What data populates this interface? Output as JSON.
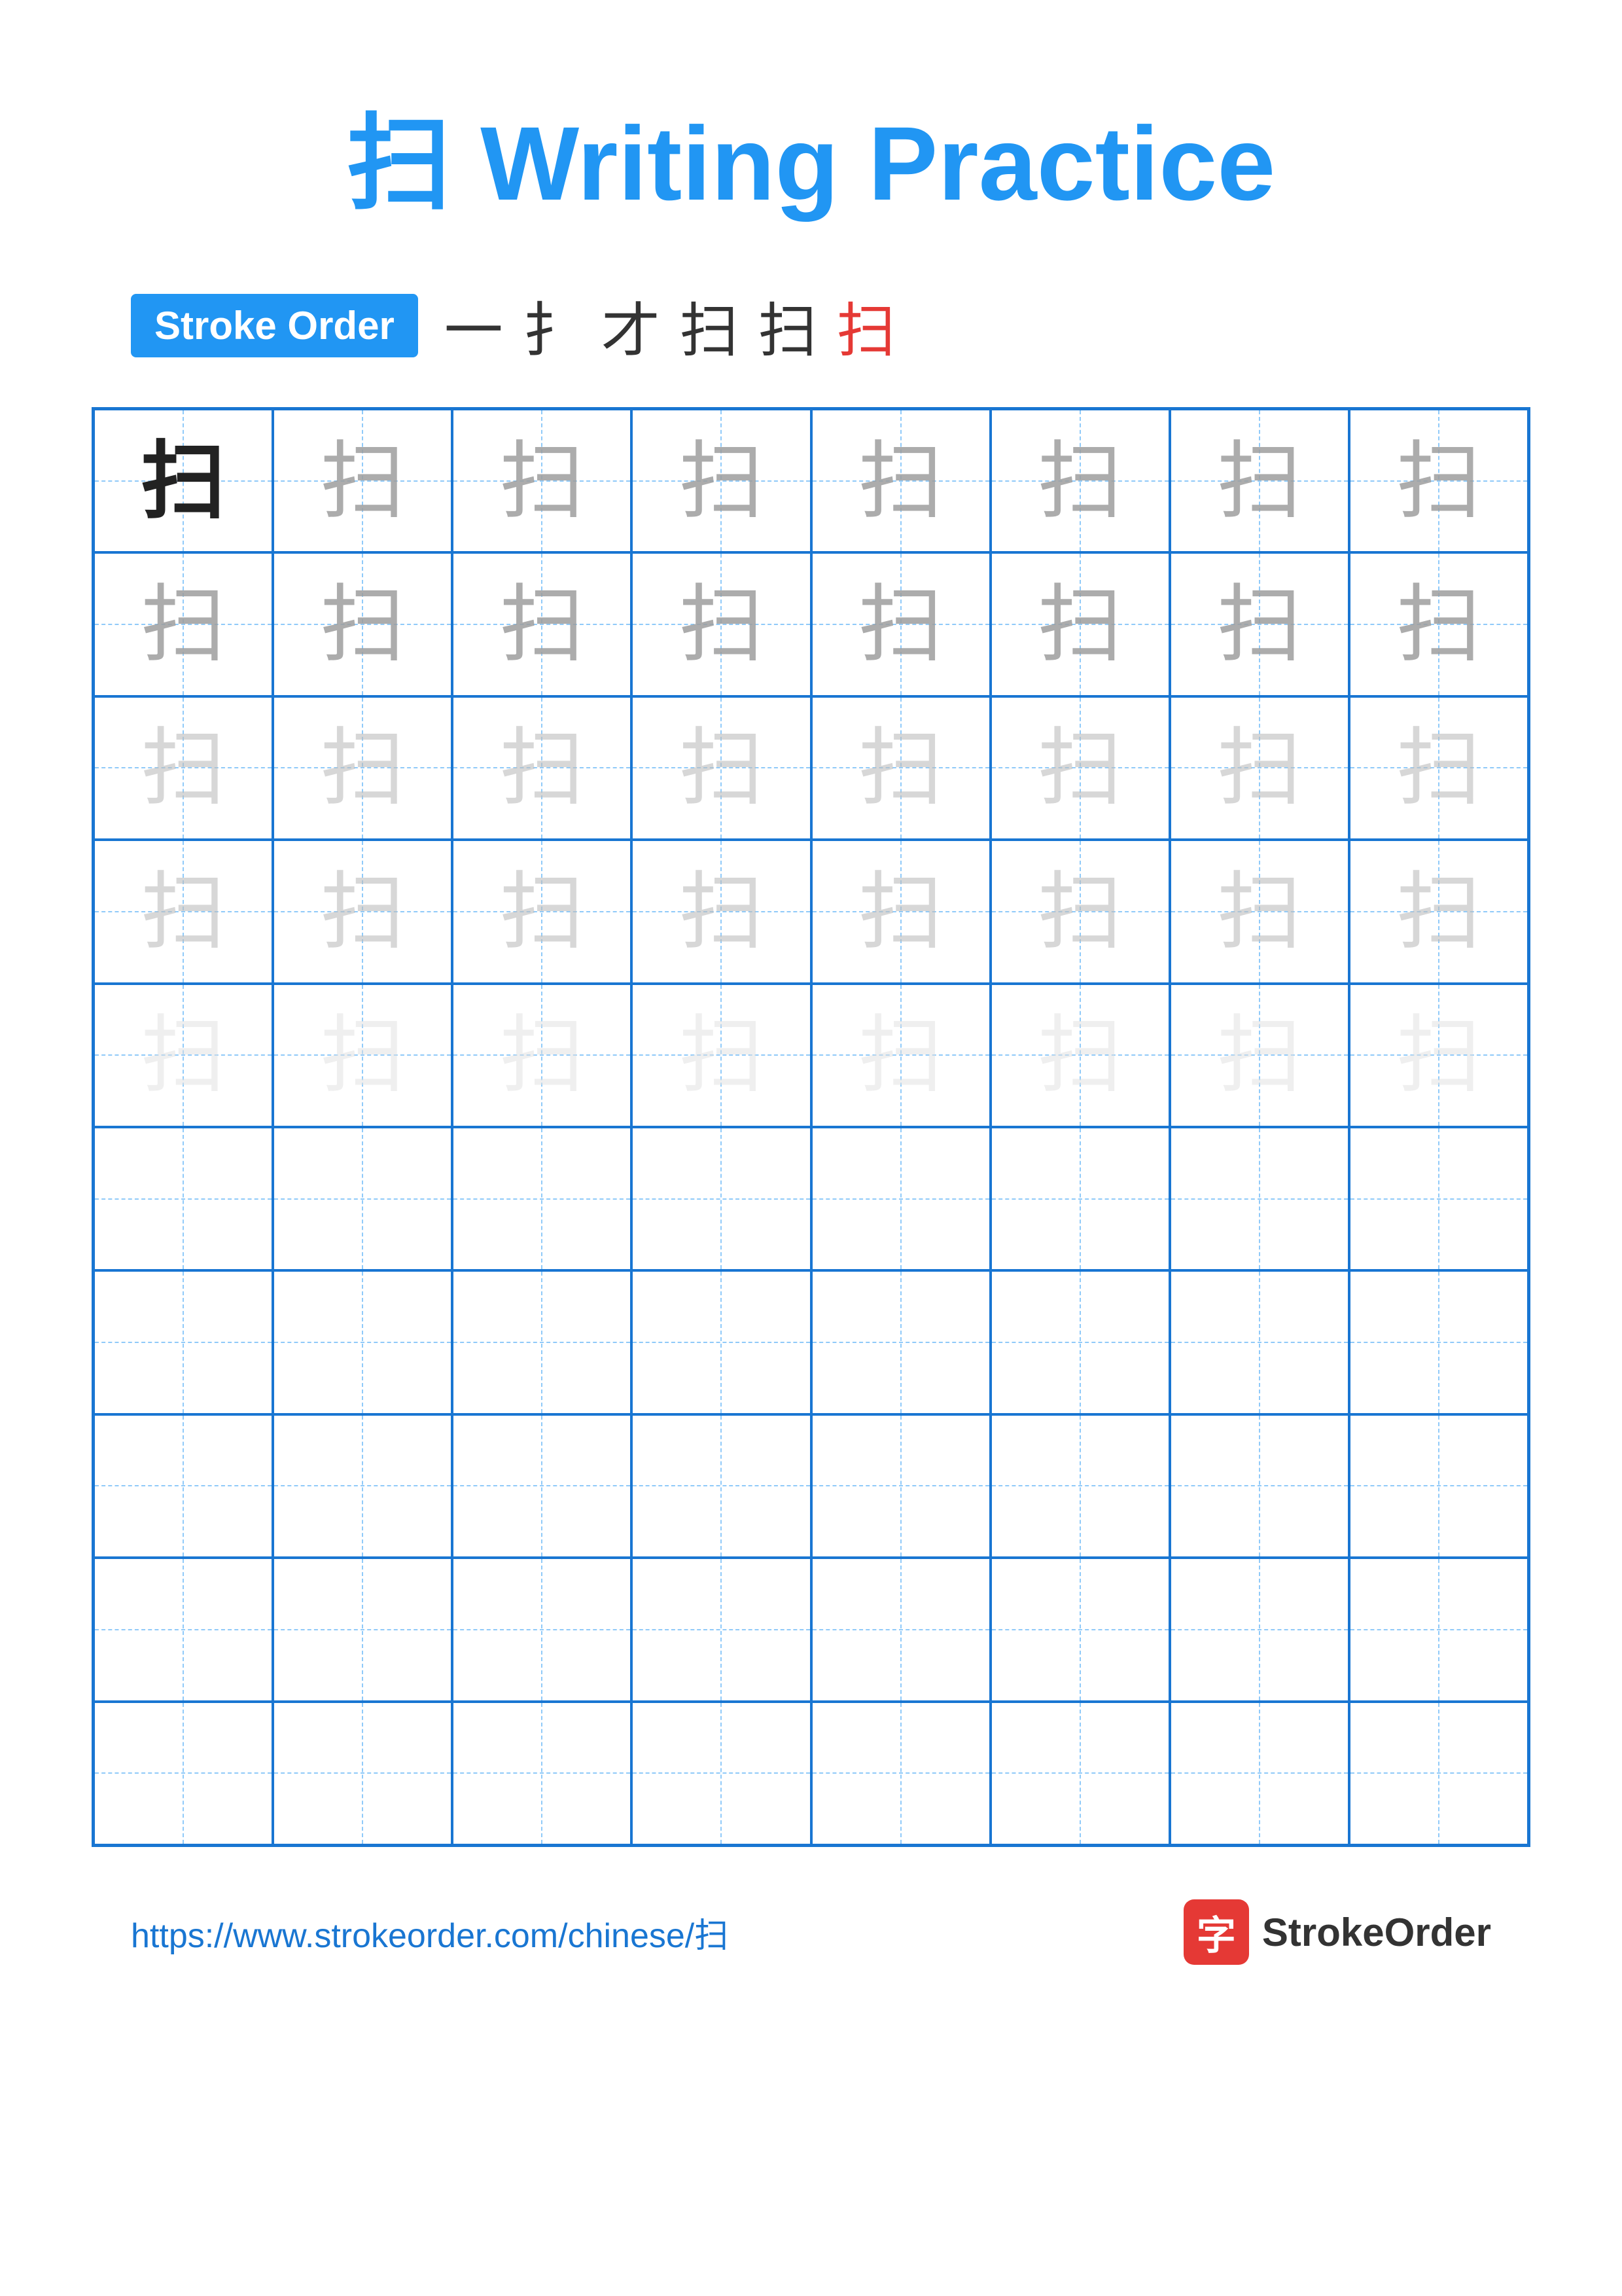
{
  "title": {
    "character": "扫",
    "label": "Writing Practice",
    "full": "扫 Writing Practice"
  },
  "stroke_order": {
    "badge_label": "Stroke Order",
    "steps": [
      "一",
      "扌",
      "才",
      "扫",
      "扫",
      "扫"
    ]
  },
  "grid": {
    "cols": 8,
    "rows": 10,
    "character": "扫",
    "practice_rows": 5,
    "empty_rows": 5
  },
  "row_shading": [
    "dark",
    "medium",
    "medium",
    "light",
    "very-light"
  ],
  "footer": {
    "url": "https://www.strokeorder.com/chinese/扫",
    "brand_name": "StrokeOrder",
    "brand_icon": "字"
  }
}
